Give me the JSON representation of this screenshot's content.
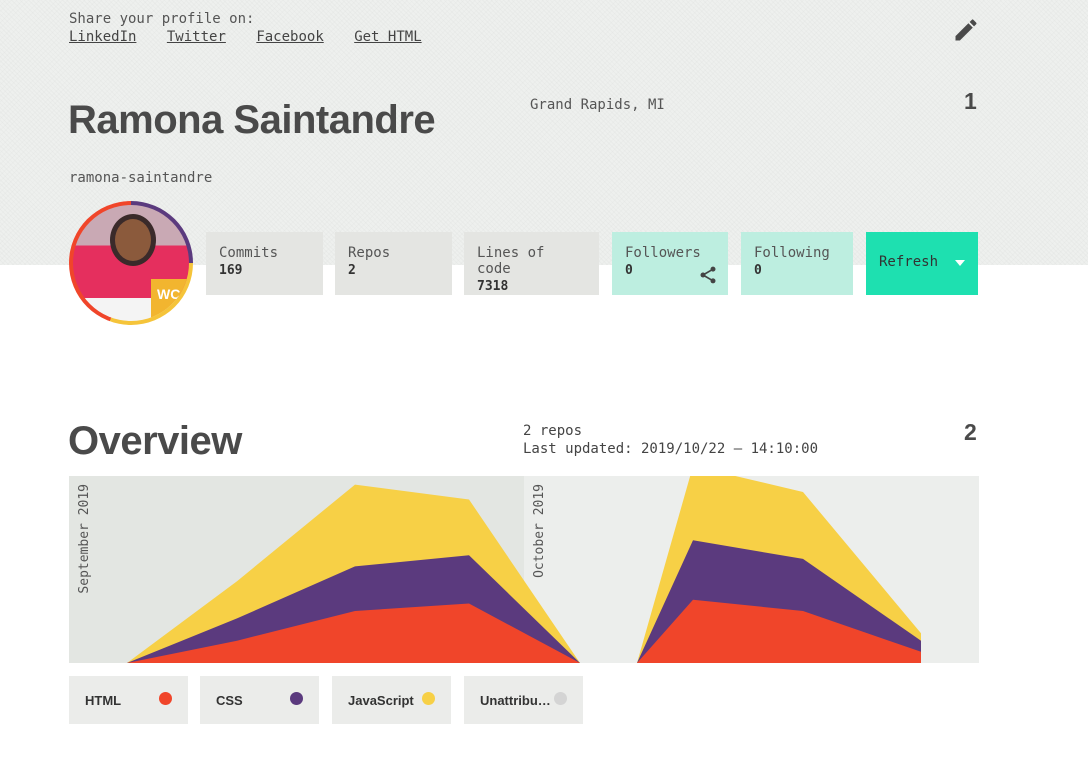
{
  "share": {
    "title": "Share your profile on:",
    "links": [
      "LinkedIn",
      "Twitter",
      "Facebook",
      "Get HTML"
    ]
  },
  "profile": {
    "name": "Ramona Saintandre",
    "location": "Grand Rapids, MI",
    "username": "ramona-saintandre",
    "section_number": "1",
    "avatar_badge": "WC"
  },
  "stats": [
    {
      "label": "Commits",
      "value": "169"
    },
    {
      "label": "Repos",
      "value": "2"
    },
    {
      "label": "Lines of code",
      "value": "7318"
    },
    {
      "label": "Followers",
      "value": "0"
    },
    {
      "label": "Following",
      "value": "0"
    }
  ],
  "refresh_label": "Refresh",
  "overview": {
    "title": "Overview",
    "section_number": "2",
    "repos": "2 repos",
    "last_updated": "Last updated: 2019/10/22 – 14:10:00"
  },
  "colors": {
    "HTML": "#f0452a",
    "CSS": "#5b3a7e",
    "JavaScript": "#f7d046",
    "Unattributed": "#d4d4d4",
    "accent": "#1ee0b0",
    "accent_light": "#bdeee0"
  },
  "chart_data": {
    "type": "area",
    "stacked": true,
    "months": [
      "September 2019",
      "October 2019"
    ],
    "x": [
      0,
      1,
      2,
      3,
      4,
      5,
      6,
      7,
      8,
      9,
      10,
      11
    ],
    "series": [
      {
        "name": "HTML",
        "values": [
          0,
          6,
          14,
          16,
          0,
          0,
          17,
          14,
          3,
          0,
          0,
          0
        ]
      },
      {
        "name": "CSS",
        "values": [
          0,
          6,
          12,
          13,
          0,
          0,
          16,
          14,
          3,
          0,
          0,
          0
        ]
      },
      {
        "name": "JavaScript",
        "values": [
          0,
          10,
          22,
          15,
          0,
          0,
          20,
          18,
          2,
          0,
          0,
          0
        ]
      }
    ],
    "legend": [
      "HTML",
      "CSS",
      "JavaScript",
      "Unattributed"
    ]
  }
}
